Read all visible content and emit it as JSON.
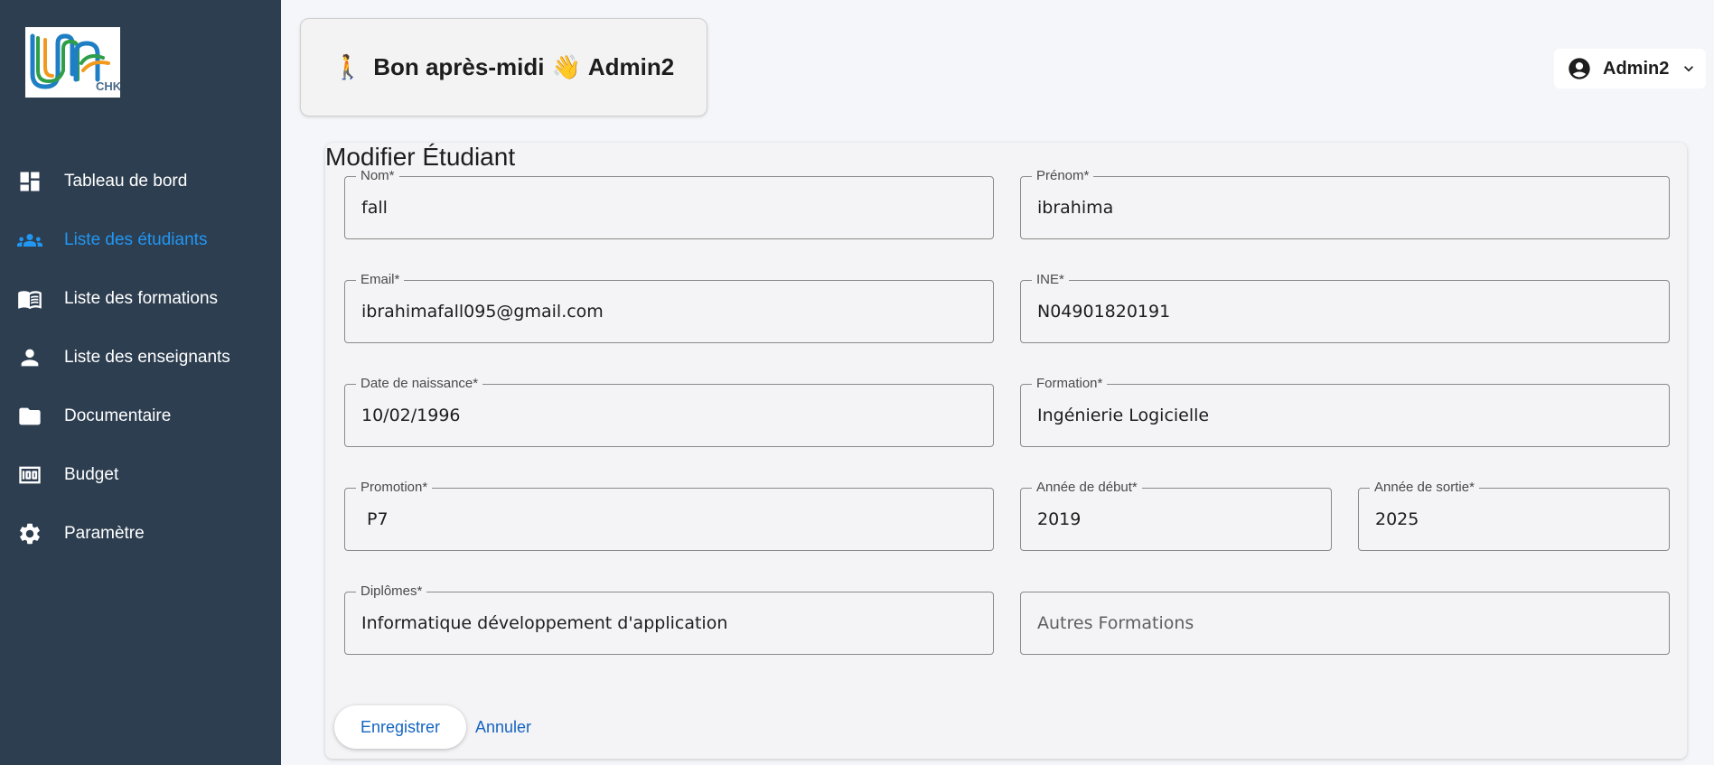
{
  "sidebar": {
    "logo_text": "CHK",
    "items": [
      {
        "label": "Tableau de bord",
        "icon": "dashboard-icon"
      },
      {
        "label": "Liste des étudiants",
        "icon": "people-icon"
      },
      {
        "label": "Liste des formations",
        "icon": "book-icon"
      },
      {
        "label": "Liste des enseignants",
        "icon": "person-icon"
      },
      {
        "label": "Documentaire",
        "icon": "folder-icon"
      },
      {
        "label": "Budget",
        "icon": "money-icon"
      },
      {
        "label": "Paramètre",
        "icon": "gear-icon"
      }
    ],
    "active_item": "Liste des étudiants",
    "active_color": "#2196f3",
    "background": "#2d3e50"
  },
  "header": {
    "greeting": "Bon après-midi",
    "greeting_name": "Admin2",
    "user_name": "Admin2"
  },
  "form": {
    "title": "Modifier Étudiant",
    "fields": {
      "nom": {
        "label": "Nom*",
        "value": "fall"
      },
      "prenom": {
        "label": "Prénom*",
        "value": "ibrahima"
      },
      "email": {
        "label": "Email*",
        "value": "ibrahimafall095@gmail.com"
      },
      "ine": {
        "label": "INE*",
        "value": "N04901820191"
      },
      "date_naissance": {
        "label": "Date de naissance*",
        "value": "10/02/1996"
      },
      "formation": {
        "label": "Formation*",
        "value": "Ingénierie Logicielle"
      },
      "promotion": {
        "label": "Promotion*",
        "value": " P7"
      },
      "annee_debut": {
        "label": "Année de début*",
        "value": "2019"
      },
      "annee_sortie": {
        "label": "Année de sortie*",
        "value": "2025"
      },
      "diplomes": {
        "label": "Diplômes*",
        "value": "Informatique développement d'application"
      },
      "autres_formations": {
        "placeholder": "Autres Formations"
      }
    },
    "save_label": "Enregistrer",
    "cancel_label": "Annuler",
    "accent_color": "#1565c0"
  }
}
